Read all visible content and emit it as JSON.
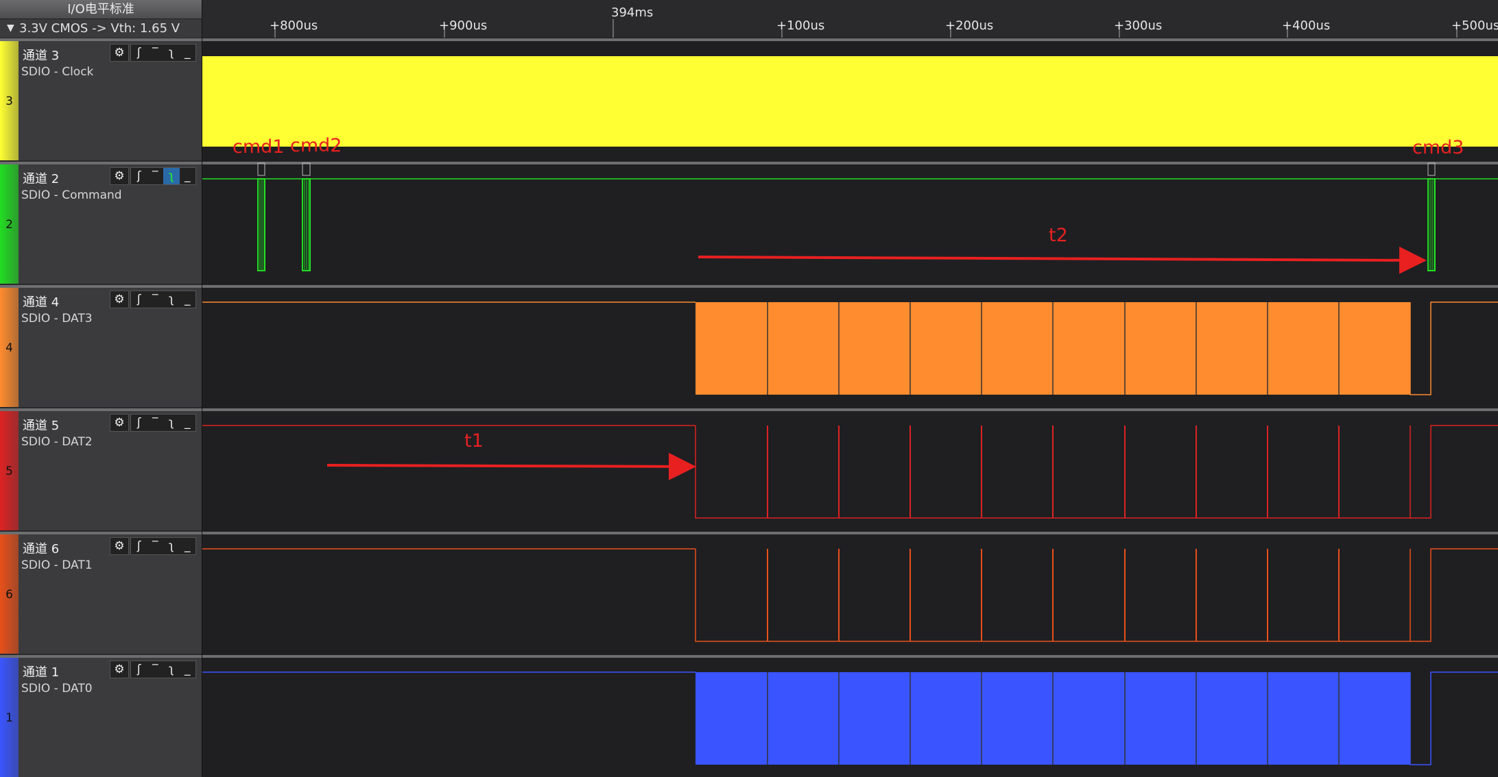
{
  "header": {
    "title": "I/O电平标准",
    "standard": "3.3V CMOS -> Vth: 1.65 V",
    "arrow_icon": "triangle-down-icon"
  },
  "timeline": {
    "center_label": "394ms",
    "ticks": [
      "+800us",
      "+900us",
      "+100us",
      "+200us",
      "+300us",
      "+400us",
      "+500us"
    ]
  },
  "channels": [
    {
      "id": "3",
      "name": "通道 3",
      "desc": "SDIO - Clock",
      "color": "#ffff33"
    },
    {
      "id": "2",
      "name": "通道 2",
      "desc": "SDIO - Command",
      "color": "#22dd22"
    },
    {
      "id": "4",
      "name": "通道 4",
      "desc": "SDIO - DAT3",
      "color": "#ff8c2e"
    },
    {
      "id": "5",
      "name": "通道 5",
      "desc": "SDIO - DAT2",
      "color": "#dd2222"
    },
    {
      "id": "6",
      "name": "通道 6",
      "desc": "SDIO - DAT1",
      "color": "#e8501a"
    },
    {
      "id": "1",
      "name": "通道 1",
      "desc": "SDIO - DAT0",
      "color": "#3a55ff"
    }
  ],
  "channel_buttons": {
    "gear_icon": "gear-icon",
    "edge_icons": [
      "rising-edge-icon",
      "high-level-icon",
      "falling-edge-icon",
      "low-level-icon"
    ]
  },
  "annotations": {
    "cmd1": "cmd1",
    "cmd2": "cmd2",
    "cmd3": "cmd3",
    "t1": "t1",
    "t2": "t2",
    "color": "#e82020"
  }
}
